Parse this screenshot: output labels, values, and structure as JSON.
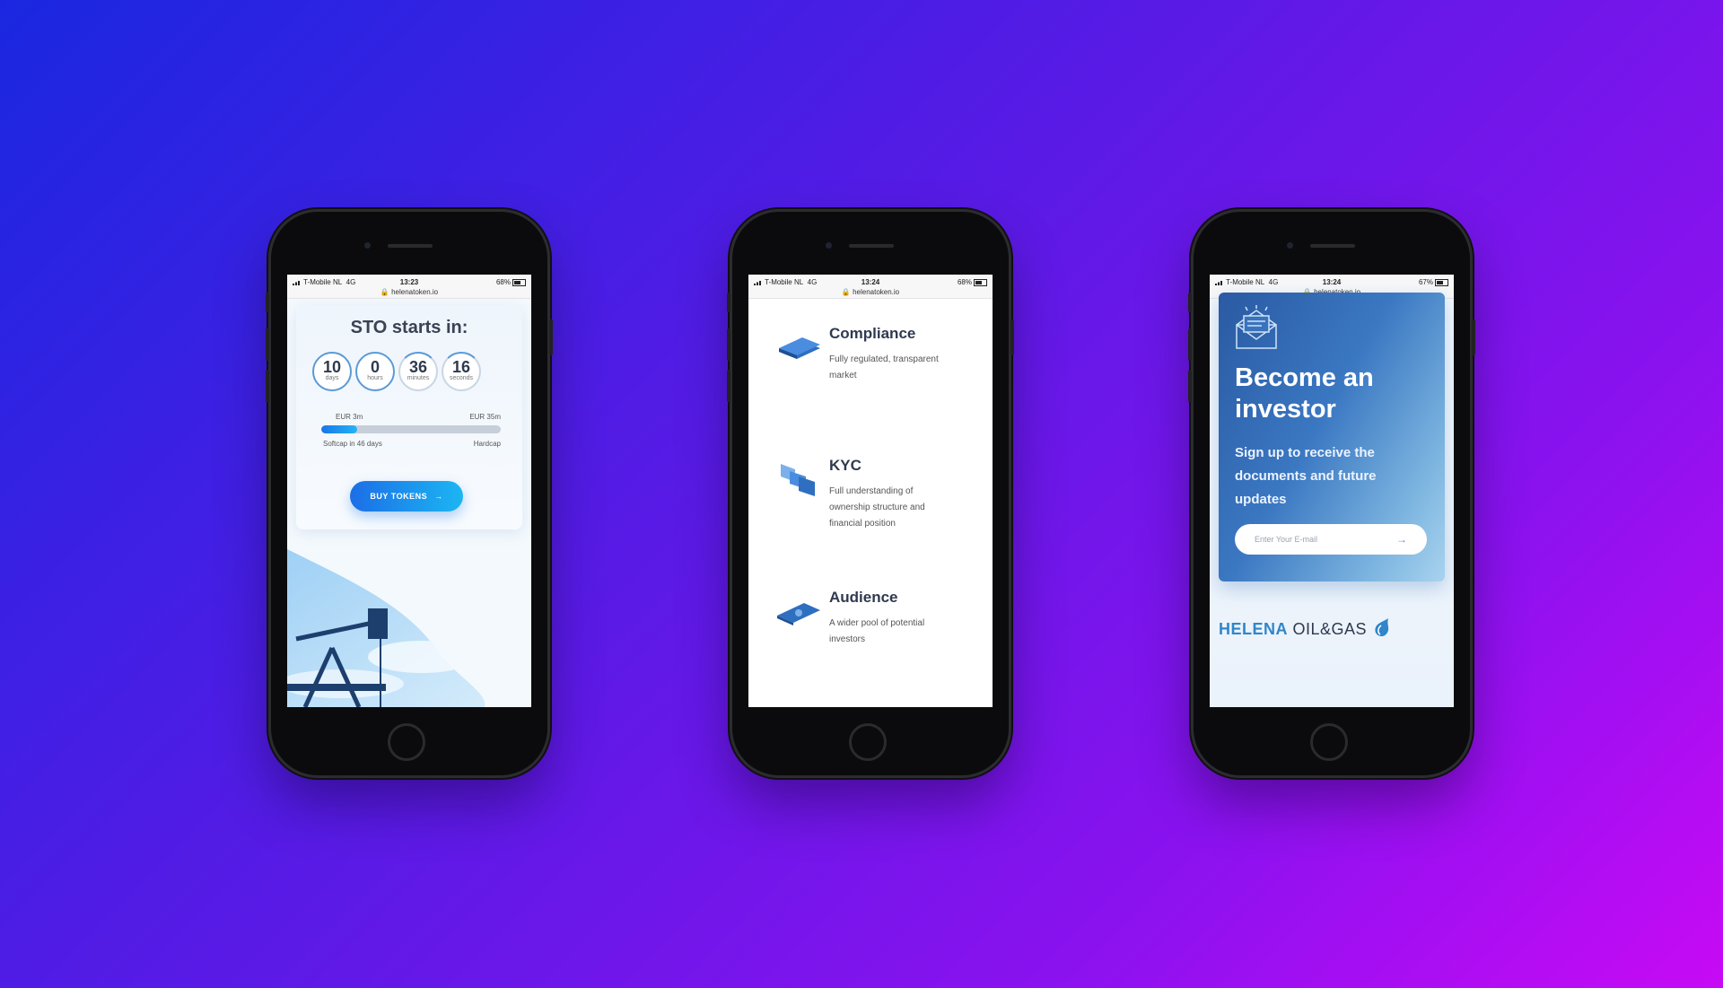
{
  "phones": [
    {
      "status": {
        "carrier": "T-Mobile NL",
        "network": "4G",
        "time": "13:23",
        "battery": "68%",
        "url": "helenatoken.io"
      },
      "sto": {
        "title": "STO starts in:",
        "countdown": [
          {
            "value": "10",
            "unit": "days"
          },
          {
            "value": "0",
            "unit": "hours"
          },
          {
            "value": "36",
            "unit": "minutes"
          },
          {
            "value": "16",
            "unit": "seconds"
          }
        ],
        "softcap_label": "EUR 3m",
        "hardcap_label": "EUR 35m",
        "progress_fraction": 0.2,
        "softcap_note": "Softcap in 46 days",
        "hardcap_note": "Hardcap",
        "buy_label": "BUY TOKENS",
        "buy_arrow": "→"
      }
    },
    {
      "status": {
        "carrier": "T-Mobile NL",
        "network": "4G",
        "time": "13:24",
        "battery": "68%",
        "url": "helenatoken.io"
      },
      "features": [
        {
          "title": "Compliance",
          "desc": "Fully regulated, transparent market",
          "icon": "card-stack-icon"
        },
        {
          "title": "KYC",
          "desc": "Full understanding of ownership structure and financial position",
          "icon": "documents-icon"
        },
        {
          "title": "Audience",
          "desc": "A wider pool of potential investors",
          "icon": "banknote-icon"
        }
      ]
    },
    {
      "status": {
        "carrier": "T-Mobile NL",
        "network": "4G",
        "time": "13:24",
        "battery": "67%",
        "url": "helenatoken.io"
      },
      "invest": {
        "title": "Become an investor",
        "subtitle": "Sign up to receive the documents and future updates",
        "email_placeholder": "Enter Your E-mail",
        "email_arrow": "→"
      },
      "logo": {
        "brand": "HELENA",
        "suffix": "OIL&GAS"
      }
    }
  ],
  "colors": {
    "accent": "#1c6ee6",
    "brand": "#2f86c9"
  }
}
